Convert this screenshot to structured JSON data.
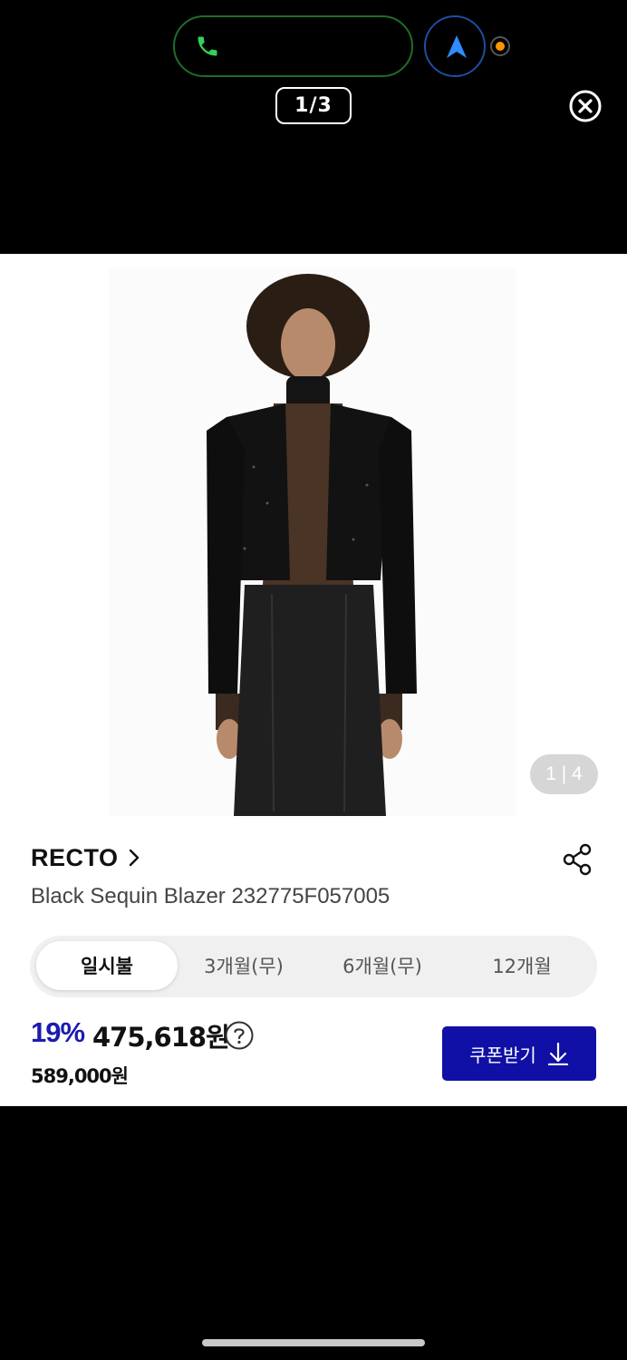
{
  "status_bar": {
    "call_icon": "phone-icon",
    "nav_icon": "navigation-arrow-icon",
    "recording_dot_color": "#ff9500"
  },
  "viewer": {
    "page_counter": "1/3",
    "close_icon": "close-icon"
  },
  "product": {
    "image_counter": "1 | 4",
    "brand": "RECTO",
    "name": "Black Sequin Blazer 232775F057005",
    "payment_tabs": [
      "일시불",
      "3개월(무)",
      "6개월(무)",
      "12개월"
    ],
    "active_tab_index": 0,
    "discount": "19%",
    "price": "475,618원",
    "original_price": "589,000원",
    "coupon_button": "쿠폰받기"
  },
  "colors": {
    "accent": "#1010a6",
    "discount": "#1b1bb0",
    "call_border": "#1f6d2b",
    "nav_border": "#1d4ea0"
  }
}
